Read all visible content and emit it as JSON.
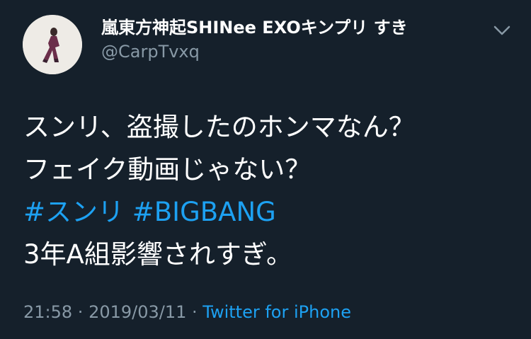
{
  "user": {
    "display_name": "嵐東方神起SHINee EXOキンプリ すき",
    "handle": "@CarpTvxq"
  },
  "tweet": {
    "line1": "スンリ、盗撮したのホンマなん？",
    "line2": "フェイク動画じゃない？",
    "hashtag1": "#スンリ",
    "hashtag2": "#BIGBANG",
    "line4": "3年A組影響されすぎ。"
  },
  "meta": {
    "time": "21:58",
    "separator1": " · ",
    "date": "2019/03/11",
    "separator2": " · ",
    "source": "Twitter for iPhone"
  },
  "icons": {
    "menu": "chevron-down-icon"
  },
  "colors": {
    "background": "#15202b",
    "text": "#ffffff",
    "secondary": "#8899a6",
    "link": "#1da1f2"
  }
}
